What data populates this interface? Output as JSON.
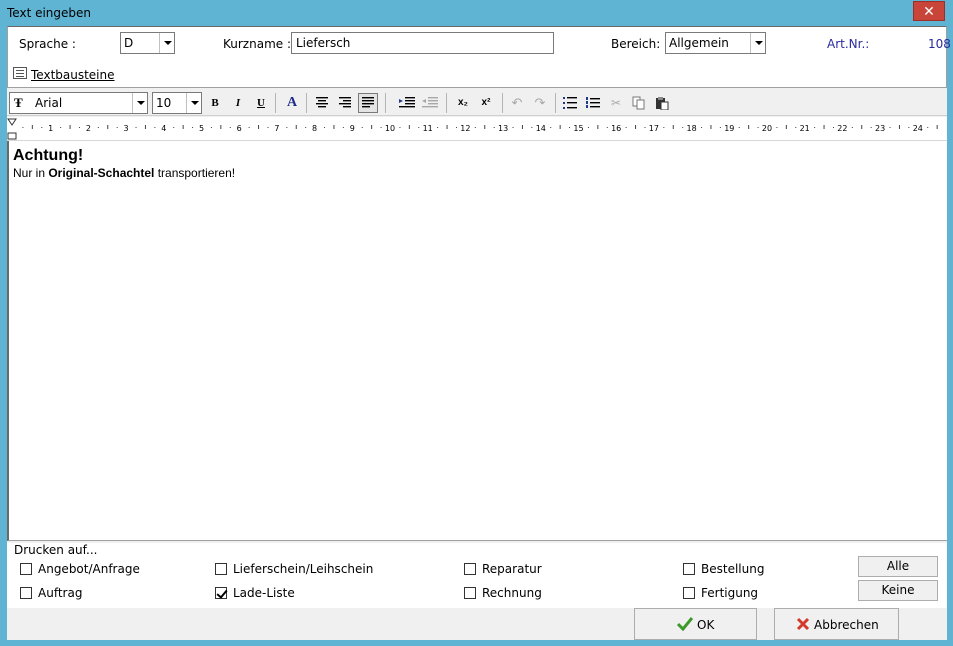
{
  "window": {
    "title": "Text eingeben",
    "close_glyph": "✕"
  },
  "form": {
    "sprache_label": "Sprache :",
    "sprache_value": "D",
    "kurzname_label": "Kurzname :",
    "kurzname_value": "Liefersch",
    "bereich_label": "Bereich:",
    "bereich_value": "Allgemein",
    "artnr_label": "Art.Nr.:",
    "artnr_value": "108",
    "textbausteine_link": "Textbausteine"
  },
  "toolbar": {
    "font_name": "Arial",
    "font_size": "10",
    "bold": "B",
    "italic": "I",
    "underline": "U",
    "font_color": "A",
    "subscript": "x₂",
    "superscript": "x²"
  },
  "ruler": {
    "ticks": [
      "1",
      "2",
      "3",
      "4",
      "5",
      "6",
      "7",
      "8",
      "9",
      "10",
      "11",
      "12",
      "13",
      "14",
      "15",
      "16",
      "17",
      "18",
      "19",
      "20",
      "21",
      "22",
      "23",
      "24"
    ]
  },
  "editor": {
    "heading": "Achtung!",
    "line_before": "Nur in ",
    "line_bold": "Original-Schachtel",
    "line_after": " transportieren!"
  },
  "print": {
    "title": "Drucken auf...",
    "options": [
      {
        "label": "Angebot/Anfrage",
        "checked": false
      },
      {
        "label": "Lieferschein/Leihschein",
        "checked": false
      },
      {
        "label": "Reparatur",
        "checked": false
      },
      {
        "label": "Bestellung",
        "checked": false
      },
      {
        "label": "Auftrag",
        "checked": false
      },
      {
        "label": "Lade-Liste",
        "checked": true
      },
      {
        "label": "Rechnung",
        "checked": false
      },
      {
        "label": "Fertigung",
        "checked": false
      }
    ],
    "alle_label": "Alle",
    "keine_label": "Keine"
  },
  "buttons": {
    "ok_label": "OK",
    "cancel_label": "Abbrechen"
  },
  "colors": {
    "title_bar": "#5fb3d3",
    "close": "#c9453a",
    "ok_check": "#3c9a2a",
    "cancel_x": "#d23a2a",
    "artnr": "#2a2aa0"
  }
}
